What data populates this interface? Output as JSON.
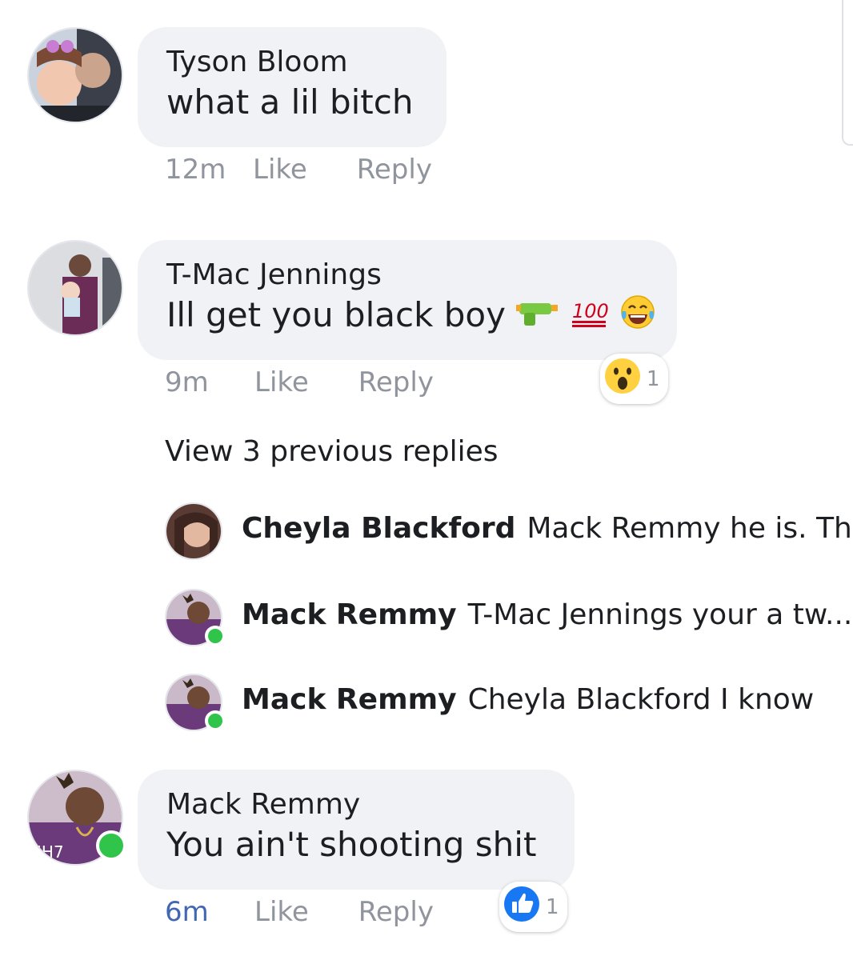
{
  "comments": [
    {
      "author": "Tyson Bloom",
      "text": "what a lil bitch",
      "time": "12m",
      "like": "Like",
      "reply": "Reply"
    },
    {
      "author": "T-Mac Jennings",
      "text": "Ill get you black boy",
      "time": "9m",
      "like": "Like",
      "reply": "Reply",
      "reaction_count": "1"
    },
    {
      "author": "Mack Remmy",
      "text": "You ain't shooting shit",
      "time": "6m",
      "like": "Like",
      "reply": "Reply",
      "reaction_count": "1"
    }
  ],
  "view_more": "View 3 previous replies",
  "replies": [
    {
      "author": "Cheyla Blackford",
      "text": "Mack Remmy he is. Th..."
    },
    {
      "author": "Mack Remmy",
      "text": "T-Mac Jennings your a tw..."
    },
    {
      "author": "Mack Remmy",
      "text": "Cheyla Blackford I know"
    }
  ],
  "colors": {
    "online": "#31c44a",
    "link_time": "#4267b2",
    "muted": "#90949c",
    "bubble": "#f0f2f5"
  },
  "icons": [
    "water-gun-emoji",
    "hundred-points-emoji",
    "tears-of-joy-emoji",
    "wow-reaction-icon",
    "like-reaction-icon"
  ]
}
